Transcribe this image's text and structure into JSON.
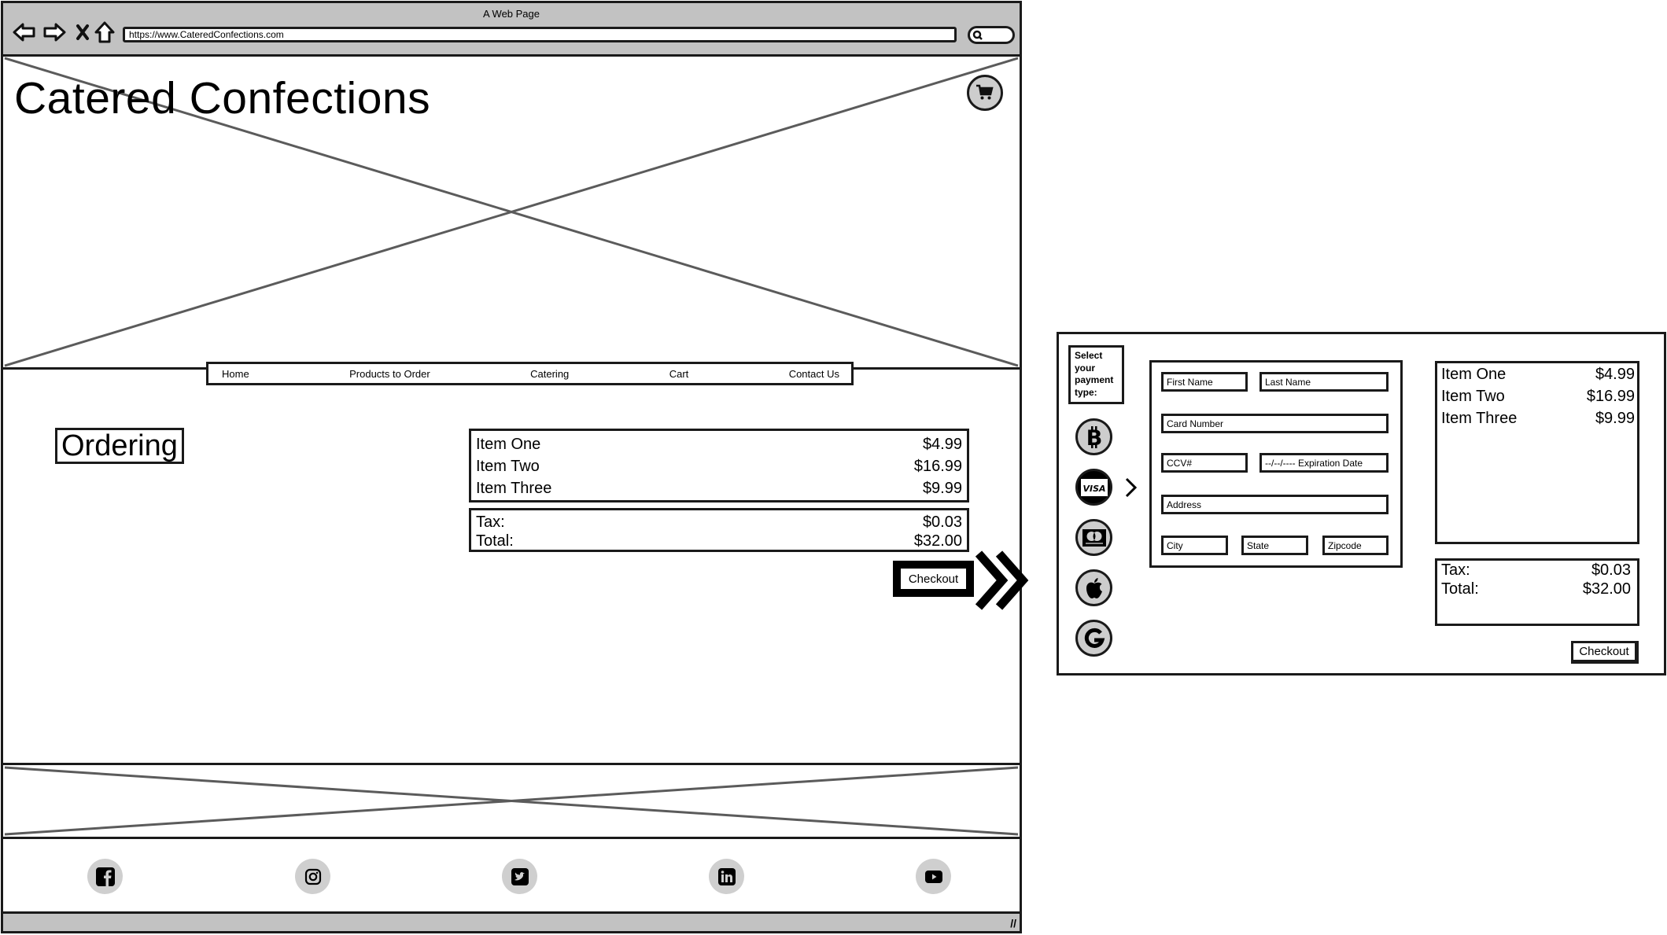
{
  "browser": {
    "window_title": "A Web Page",
    "url": "https://www.CateredConfections.com",
    "nav_icons": [
      "back-arrow-icon",
      "forward-arrow-icon",
      "stop-icon",
      "home-icon"
    ],
    "search_icon": "search-icon"
  },
  "header": {
    "site_title": "Catered Confections",
    "cart_icon": "shopping-cart-icon"
  },
  "nav": {
    "items": [
      {
        "label": "Home"
      },
      {
        "label": "Products to Order"
      },
      {
        "label": "Catering"
      },
      {
        "label": "Cart"
      },
      {
        "label": "Contact Us"
      }
    ]
  },
  "main": {
    "heading": "Ordering",
    "order_items": [
      {
        "name": "Item One",
        "price": "$4.99"
      },
      {
        "name": "Item Two",
        "price": "$16.99"
      },
      {
        "name": "Item Three",
        "price": "$9.99"
      }
    ],
    "tax_label": "Tax:",
    "tax_value": "$0.03",
    "total_label": "Total:",
    "total_value": "$32.00",
    "checkout_label": "Checkout"
  },
  "footer": {
    "social": [
      "facebook",
      "instagram",
      "twitter",
      "linkedin",
      "youtube"
    ]
  },
  "payment_panel": {
    "select_label": "Select your payment type:",
    "methods": [
      "bitcoin",
      "visa",
      "mastercard",
      "apple-pay",
      "google-pay"
    ],
    "selected_method": "visa",
    "visa_text": "VISA",
    "fields": {
      "first_name": "First Name",
      "last_name": "Last Name",
      "card_number": "Card Number",
      "ccv": "CCV#",
      "expiration": "--/--/---- Expiration Date",
      "address": "Address",
      "city": "City",
      "state": "State",
      "zipcode": "Zipcode"
    },
    "order_items": [
      {
        "name": "Item One",
        "price": "$4.99"
      },
      {
        "name": "Item Two",
        "price": "$16.99"
      },
      {
        "name": "Item Three",
        "price": "$9.99"
      }
    ],
    "tax_label": "Tax:",
    "tax_value": "$0.03",
    "total_label": "Total:",
    "total_value": "$32.00",
    "checkout_label": "Checkout"
  }
}
